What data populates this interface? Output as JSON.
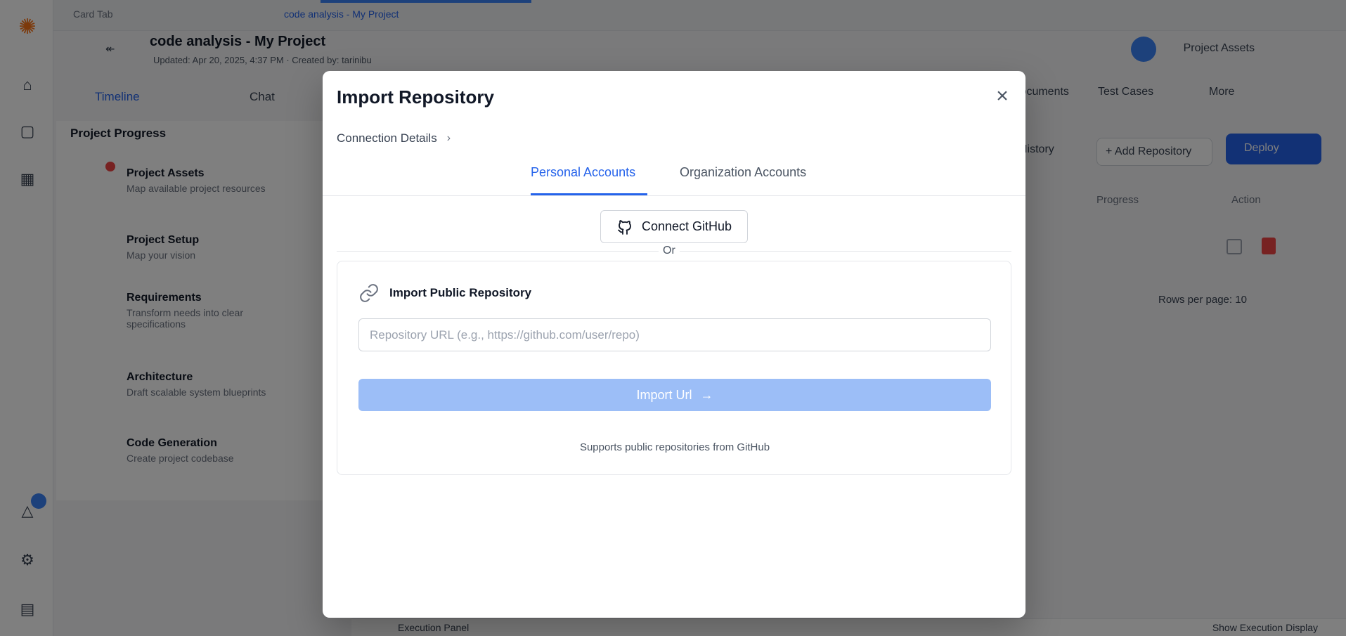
{
  "background": {
    "tabs": [
      {
        "label": "Card Tab"
      },
      {
        "label": "code analysis - My Project"
      }
    ],
    "project": {
      "title": "code analysis - My Project",
      "meta": "Updated: Apr 20, 2025, 4:37 PM · Created by: tarinibu"
    },
    "project_assets_label": "Project Assets",
    "subtabs": {
      "timeline": "Timeline",
      "chat": "Chat",
      "documents": "Documents",
      "test_cases": "Test Cases",
      "more": "More"
    },
    "progress": {
      "title": "Project Progress",
      "steps": [
        {
          "title": "Project Assets",
          "desc": "Map available project resources"
        },
        {
          "title": "Project Setup",
          "desc": "Map your vision"
        },
        {
          "title": "Requirements",
          "desc": "Transform needs into clear specifications"
        },
        {
          "title": "Architecture",
          "desc": "Draft scalable system blueprints"
        },
        {
          "title": "Code Generation",
          "desc": "Create project codebase"
        }
      ]
    },
    "history_label": "History",
    "add_repository_label": "+ Add Repository",
    "deploy_label": "Deploy",
    "table_headers": {
      "progress": "Progress",
      "action": "Action"
    },
    "rows_per_page_label": "Rows per page: 10",
    "bottom_left": "Execution Panel",
    "bottom_right": "Show Execution Display"
  },
  "modal": {
    "title": "Import Repository",
    "breadcrumb": "Connection Details",
    "tabs": [
      {
        "label": "Personal Accounts",
        "active": true
      },
      {
        "label": "Organization Accounts",
        "active": false
      }
    ],
    "connect_github_label": "Connect GitHub",
    "or_label": "Or",
    "public_repo": {
      "title": "Import Public Repository",
      "url_placeholder": "Repository URL (e.g., https://github.com/user/repo)",
      "url_value": "",
      "import_button_label": "Import Url",
      "note": "Supports public repositories from GitHub"
    }
  },
  "colors": {
    "accent": "#2563eb",
    "import_disabled": "#9cbef7",
    "overlay": "rgba(0,0,0,0.5)"
  },
  "icons": {
    "close": "close-icon",
    "breadcrumb": "chevron-right-icon",
    "github": "github-icon",
    "link": "link-icon",
    "arrow": "arrow-right-icon"
  }
}
